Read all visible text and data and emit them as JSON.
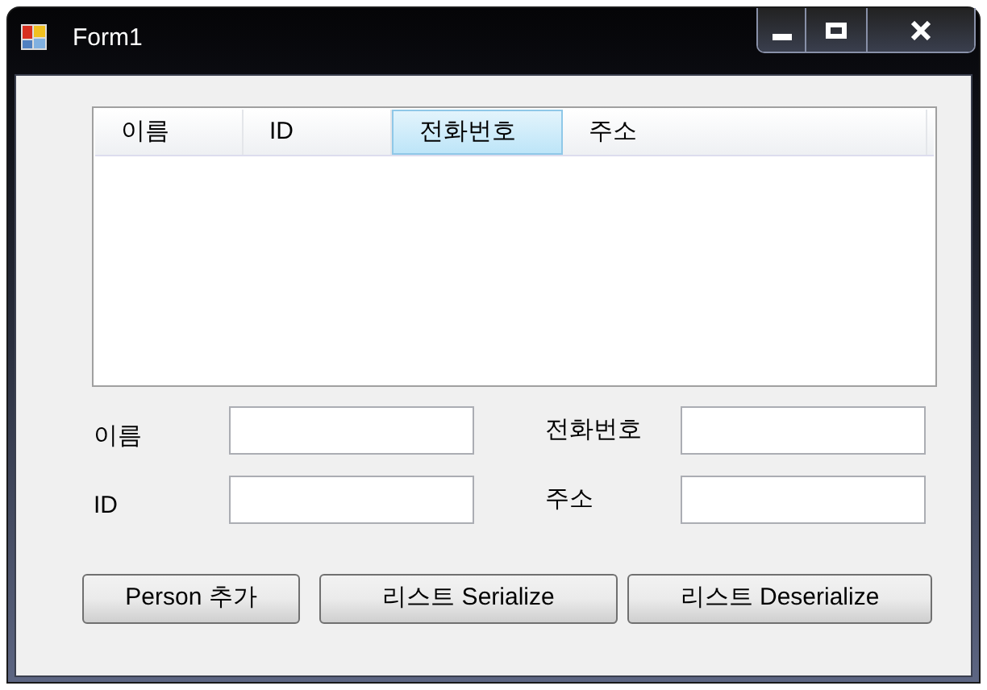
{
  "window": {
    "title": "Form1"
  },
  "list_view": {
    "columns": [
      {
        "label": "이름",
        "selected": false
      },
      {
        "label": "ID",
        "selected": false
      },
      {
        "label": "전화번호",
        "selected": true
      },
      {
        "label": "주소",
        "selected": false
      }
    ]
  },
  "fields": [
    {
      "label": "이름"
    },
    {
      "label": "전화번호"
    },
    {
      "label": "ID"
    },
    {
      "label": "주소"
    }
  ],
  "buttons": [
    "Person 추가",
    "리스트 Serialize",
    "리스트 Deserialize"
  ]
}
